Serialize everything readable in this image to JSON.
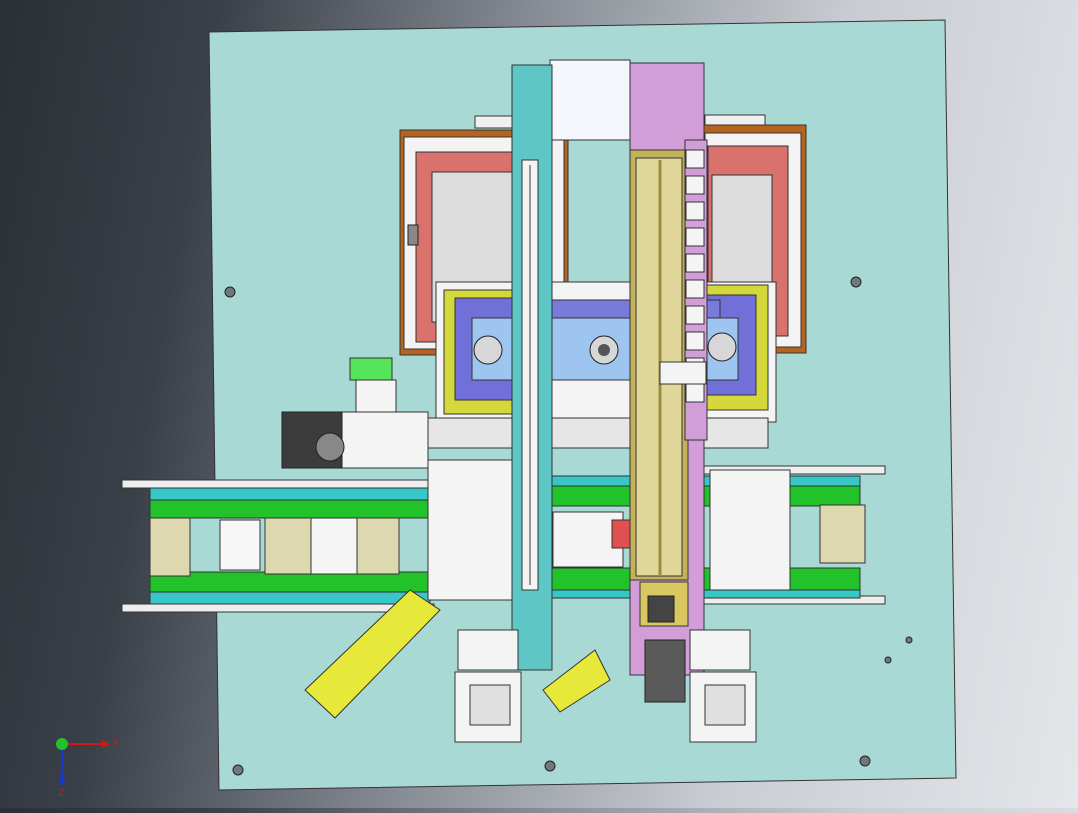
{
  "view": {
    "colors": {
      "base_plate": "#a9d9d4",
      "frame_red": "#d9716c",
      "frame_brown": "#b4641e",
      "belt_green": "#22c22a",
      "cyan_bar": "#5ec6c4",
      "pink_rail": "#d29ed8",
      "blue_plate": "#9ec4f0",
      "yellow": "#e6e83a",
      "olive_rail": "#c4b25a",
      "gold_rail": "#e2d79a"
    }
  },
  "triad": {
    "x_label": "X",
    "z_label": "Z"
  }
}
